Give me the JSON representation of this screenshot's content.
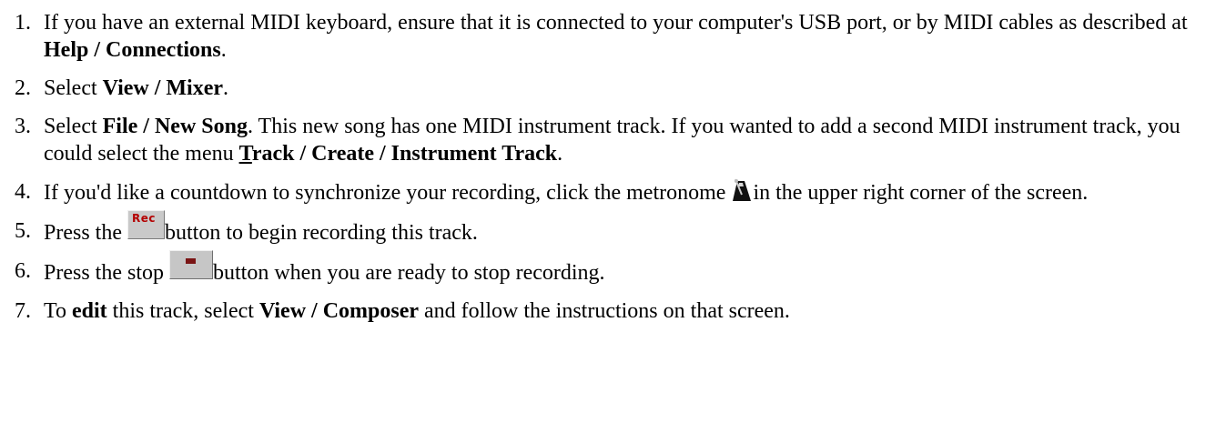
{
  "steps": [
    {
      "num": "1.",
      "text_a": "If you have an external MIDI keyboard, ensure that it is connected to your computer's USB port, or by MIDI cables as described at ",
      "bold_a": "Help / Connections",
      "text_b": "."
    },
    {
      "num": "2.",
      "text_a": "Select ",
      "bold_a": "View / Mixer",
      "text_b": "."
    },
    {
      "num": "3.",
      "text_a": "Select ",
      "bold_a": "File / New Song",
      "text_b": ". This new song has one MIDI instrument track. If you wanted to add a second MIDI instrument track, you could select the menu ",
      "bold_u": "T",
      "bold_b": "rack / Create / Instrument Track",
      "text_c": "."
    },
    {
      "num": "4.",
      "text_a": "If you'd like a countdown to synchronize your recording, click the metronome ",
      "icon": "metronome-icon",
      "text_b": "in the upper right corner of the screen."
    },
    {
      "num": "5.",
      "text_a": "Press the ",
      "button_label": "Rec",
      "text_b": "button to begin recording this track."
    },
    {
      "num": "6.",
      "text_a": "Press the stop ",
      "icon": "stop-icon",
      "text_b": "button when you are ready to stop recording."
    },
    {
      "num": "7.",
      "text_a": "To ",
      "bold_a": "edit",
      "text_b": " this track, select ",
      "bold_b": "View / Composer",
      "text_c": " and follow the instructions on that screen."
    }
  ]
}
